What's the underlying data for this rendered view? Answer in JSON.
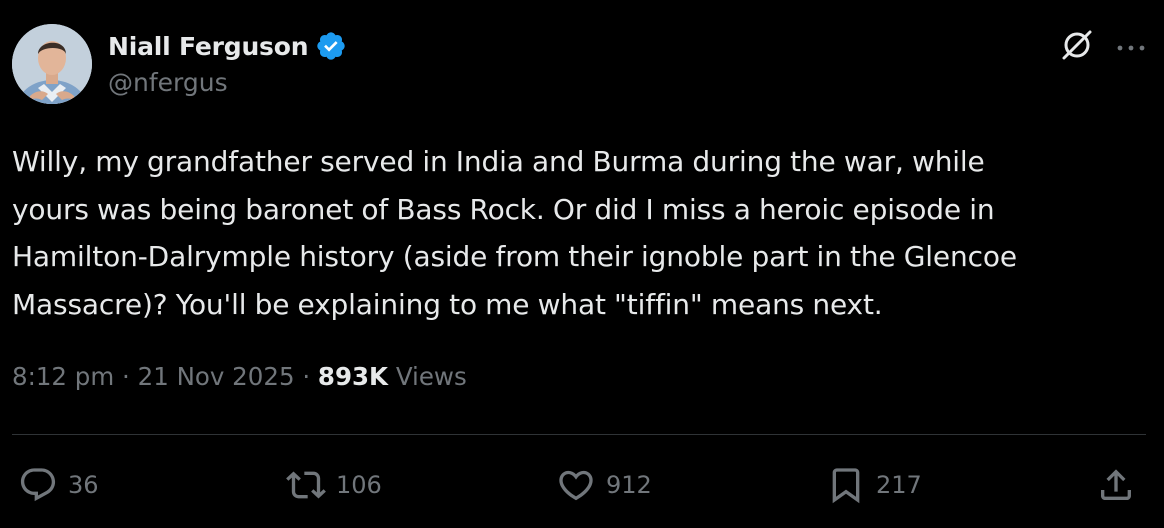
{
  "author": {
    "display_name": "Niall Ferguson",
    "handle": "@nfergus",
    "verified": true,
    "verified_color": "#1d9bf0"
  },
  "header_icons": {
    "grok": "grok-icon",
    "more": "more-icon"
  },
  "tweet": {
    "text": "Willy, my grandfather served in India and Burma during the war, while\nyours was being baronet of Bass Rock. Or did I miss a heroic episode in\nHamilton-Dalrymple history (aside from their ignoble part in the Glencoe\nMassacre)? You'll be explaining to me what \"tiffin\" means next."
  },
  "meta": {
    "time": "8:12 pm",
    "separator": " · ",
    "date": "21 Nov 2025",
    "views_count": "893K",
    "views_label": " Views"
  },
  "actions": {
    "reply": {
      "icon": "reply-icon",
      "count": "36"
    },
    "retweet": {
      "icon": "retweet-icon",
      "count": "106"
    },
    "like": {
      "icon": "heart-icon",
      "count": "912"
    },
    "bookmark": {
      "icon": "bookmark-icon",
      "count": "217"
    },
    "share": {
      "icon": "share-icon"
    }
  },
  "colors": {
    "background": "#000000",
    "text_primary": "#e7e9ea",
    "text_secondary": "#71767b",
    "divider": "#2f3336"
  }
}
